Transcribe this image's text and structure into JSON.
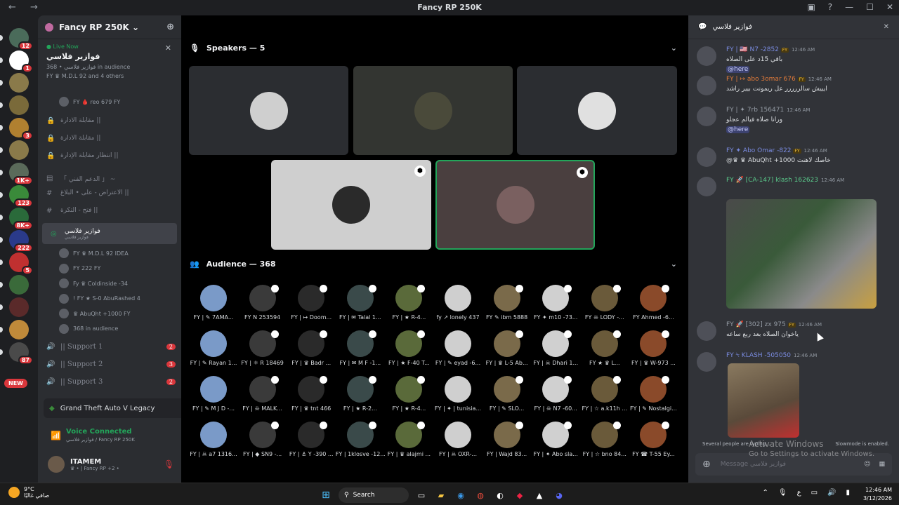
{
  "window": {
    "title": "Fancy RP 250K",
    "nav": "← →"
  },
  "servers": [
    {
      "badge": "12",
      "color": "#4a6b5a"
    },
    {
      "badge": "1",
      "color": "#ffffff"
    },
    {
      "badge": "",
      "color": "#8a7a4a"
    },
    {
      "badge": "",
      "color": "#7a6a3a"
    },
    {
      "badge": "3",
      "color": "#b08030"
    },
    {
      "badge": "",
      "color": "#8a7a4a"
    },
    {
      "badge": "1K+",
      "color": "#5a6a5a"
    },
    {
      "badge": "123",
      "color": "#3a8a3a"
    },
    {
      "badge": "8K+",
      "color": "#2a6a3a"
    },
    {
      "badge": "222",
      "color": "#2a3a8a"
    },
    {
      "badge": "5",
      "color": "#c03030"
    },
    {
      "badge": "",
      "color": "#3a6a3a"
    },
    {
      "badge": "",
      "color": "#5a2a2a"
    },
    {
      "badge": "",
      "color": "#c08a3a"
    },
    {
      "badge": "87",
      "color": "#4a4a4a"
    }
  ],
  "new_badge": "NEW",
  "guild": {
    "name": "Fancy RP 250K ⌄"
  },
  "live": {
    "label": "● Live Now",
    "title": "فوازير فلاسي",
    "stats": "فوازير فلاسي • 368 in audience",
    "users": "FY ♛ M.D.L 92 and 4 others"
  },
  "top_user": "FY 🩸 reo 679 FY",
  "channels": [
    {
      "icon": "🔒",
      "label": "مقابلة الادارة ||"
    },
    {
      "icon": "🔒",
      "label": "مقابلة الادارة ||"
    },
    {
      "icon": "🔒",
      "label": "انتظار مقابلة الإدارة ||"
    },
    {
      "icon": "▤",
      "label": "「 الدعم الفني 」 ~"
    },
    {
      "icon": "#",
      "label": "الاعتراض - على • البلاغ ||"
    },
    {
      "icon": "#",
      "label": "فتح - التكرة ||"
    }
  ],
  "active_channel": {
    "label": "فوازير فلاسي",
    "sub": "فوازير فلاسي"
  },
  "voice_users": [
    "FY ♛ M.D.L 92  IDEA",
    "FY 222 FY",
    "Fy ♛ Coldinside -34",
    "! FY ★ S-0 AbuRashed 4",
    "♛ AbuQht +1000 FY",
    "368 in audience"
  ],
  "support": [
    {
      "label": "|| Support 1",
      "count": "2"
    },
    {
      "label": "|| Support 2",
      "count": "3"
    },
    {
      "label": "|| Support 3",
      "count": "2"
    }
  ],
  "game": "Grand Theft Auto V Legacy",
  "voice": {
    "status": "Voice Connected",
    "sub": "فوازير فلاسي / Fancy RP 250K"
  },
  "user": {
    "name": "ITAMEM",
    "status": "♛ • | Fancy RP +2 •"
  },
  "stage": {
    "speakers_label": "Speakers — 5",
    "audience_label": "Audience — 368"
  },
  "audience": [
    "FY | ✎ 7AMA...",
    "FY N 253594",
    "FY | ↦ Doom...",
    "FY | ✉ Talal 1...",
    "FY | ★ R-4...",
    "fy ↗ lonely 437",
    "FY ✎ ibm 5888",
    "FY ✦ m10 -73...",
    "FY ☠ LODY -...",
    "FY Ahmed -6...",
    "FY | ✎ Rayan 1...",
    "FY | ⚛ R 18469",
    "FY | ♛ Badr ...",
    "FY | ✉ M F -1...",
    "FY | ★ F-40 T...",
    "FY | ✎ eyad -6...",
    "FY | ♛ L-5 Ab...",
    "FY | ☠ Dhari 1...",
    "FY ★ ♛ L...",
    "FY | ♛ W-973 ...",
    "FY | ✎ M J D -...",
    "FY | ☠ MALK...",
    "FY | ♛ tnt 466",
    "FY | ★ R-2...",
    "FY | ★ R-4...",
    "FY | ✦ | tunisia...",
    "FY | ✎ SLO...",
    "FY | ☠ N7 -60...",
    "FY | ☆ a.k11h ...",
    "FY | ✎ Nostalgi...",
    "FY | ☠ a7 1316...",
    "FY | ◆ SN9 -...",
    "FY | ⚓ Y -390 ...",
    "FY | 1klosve -12...",
    "FY | ♛ alajmi ...",
    "FY | ☠ OXR-...",
    "FY | Wajd 83...",
    "FY | ✦ Abo sla...",
    "FY | ☆ bno 84...",
    "FY ☎ T-55 Ey..."
  ],
  "chat": {
    "title": "فوازير فلاسي",
    "messages": [
      {
        "author": "FY | 🇺🇸 N7 -2852",
        "tag": "FY",
        "time": "12:46 AM",
        "text": "باقي 15د على الصلاه",
        "mention": "@here",
        "color": "#7a8be0"
      },
      {
        "author": "FY | ↦ abo 3omar 676",
        "tag": "FY",
        "time": "12:46 AM",
        "text": "ايييش سالررررر عل ريمونت بيير راشد",
        "mention": "",
        "color": "#e07a3a"
      },
      {
        "author": "FY | ✦ 7rb 156471",
        "tag": "",
        "time": "12:46 AM",
        "text": "ورانا صلاه فيالم عجلو",
        "mention": "@here",
        "color": "#949ba4"
      },
      {
        "author": "FY ✦ Abo Omar -822",
        "tag": "FY",
        "time": "12:46 AM",
        "text": "@♛ ♛ AbuQht +1000 خاصك لاهنت",
        "mention": "",
        "color": "#7a8be0"
      },
      {
        "author": "FY 🚀 [CA-147] klash 162623",
        "tag": "",
        "time": "12:46 AM",
        "text": "",
        "mention": "",
        "color": "#5ac88a"
      },
      {
        "author": "FY 🚀 [302] zx 975",
        "tag": "FY",
        "time": "12:46 AM",
        "text": "ياخوان الصلاه بعد ربع ساعه",
        "mention": "",
        "color": "#949ba4"
      },
      {
        "author": "FY ⍀ KLASH -505050",
        "tag": "",
        "time": "12:46 AM",
        "text": "",
        "mention": "",
        "color": "#7a8be0"
      }
    ],
    "typing": "Several people are typing...",
    "slowmode": "Slowmode is enabled.",
    "placeholder": "Message فوازير فلاسي"
  },
  "watermark": {
    "line1": "Activate Windows",
    "line2": "Go to Settings to activate Windows."
  },
  "taskbar": {
    "temp": "9°C",
    "weather": "صافي غالبًا",
    "search": "Search",
    "time": "12:46 AM",
    "date": "3/12/2026",
    "lang": "ع"
  }
}
